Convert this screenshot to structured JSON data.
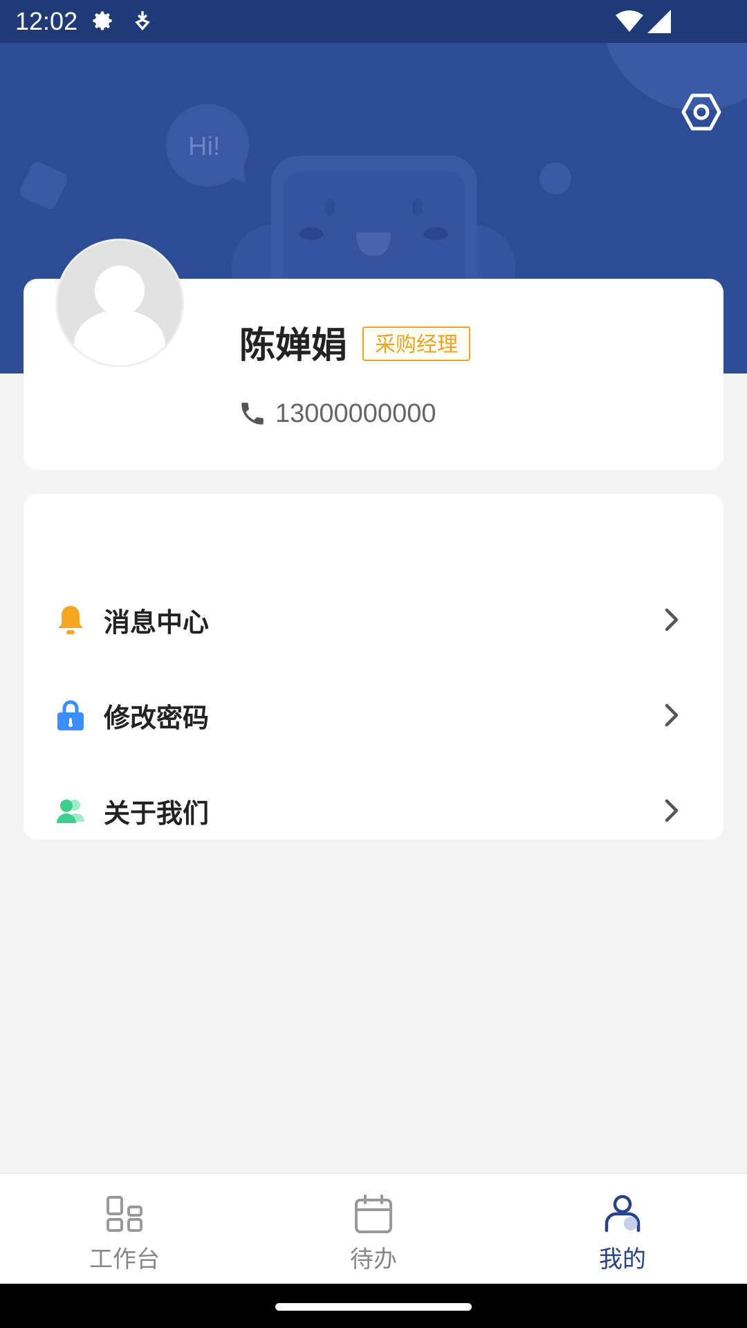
{
  "status_bar": {
    "time": "12:02"
  },
  "profile": {
    "name": "陈婵娟",
    "role": "采购经理",
    "phone": "13000000000"
  },
  "menu": {
    "items": [
      {
        "label": "消息中心",
        "icon": "bell-icon",
        "color": "#f5a623"
      },
      {
        "label": "修改密码",
        "icon": "lock-icon",
        "color": "#3a8dfa"
      },
      {
        "label": "关于我们",
        "icon": "users-icon",
        "color": "#3ecf8e"
      }
    ]
  },
  "bottom_nav": {
    "tabs": [
      {
        "label": "工作台",
        "icon": "dashboard-icon",
        "active": false
      },
      {
        "label": "待办",
        "icon": "calendar-icon",
        "active": false
      },
      {
        "label": "我的",
        "icon": "user-icon",
        "active": true
      }
    ]
  },
  "hero": {
    "greeting": "Hi!"
  },
  "colors": {
    "header": "#2e4b95",
    "status_bar": "#203a78",
    "accent": "#27428d",
    "badge": "#f0a31a"
  }
}
